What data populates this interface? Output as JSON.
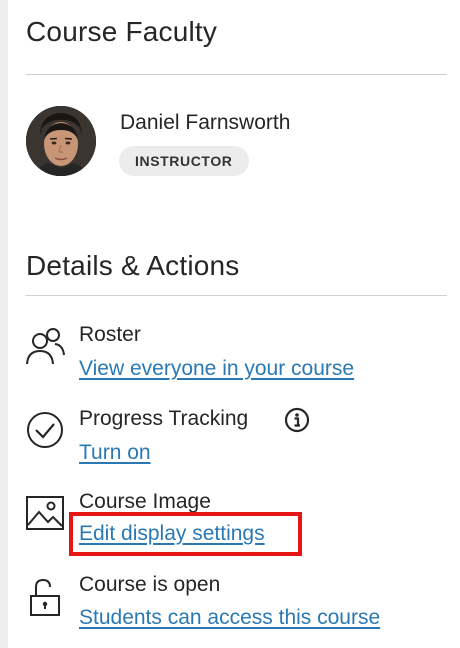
{
  "faculty": {
    "heading": "Course Faculty",
    "instructor_name": "Daniel Farnsworth",
    "instructor_role": "INSTRUCTOR"
  },
  "details": {
    "heading": "Details & Actions",
    "rows": [
      {
        "title": "Roster",
        "link": "View everyone in your course",
        "icon": "users-icon"
      },
      {
        "title": "Progress Tracking",
        "link": "Turn on",
        "icon": "checkmark-circle-icon",
        "extra_icon": "info-icon"
      },
      {
        "title": "Course Image",
        "link": "Edit display settings",
        "icon": "image-icon"
      },
      {
        "title": "Course is open",
        "link": "Students can access this course",
        "icon": "unlocked-padlock-icon"
      }
    ]
  },
  "colors": {
    "link": "#2a79b5",
    "highlight": "#e81515",
    "badge_bg": "#ececec"
  }
}
